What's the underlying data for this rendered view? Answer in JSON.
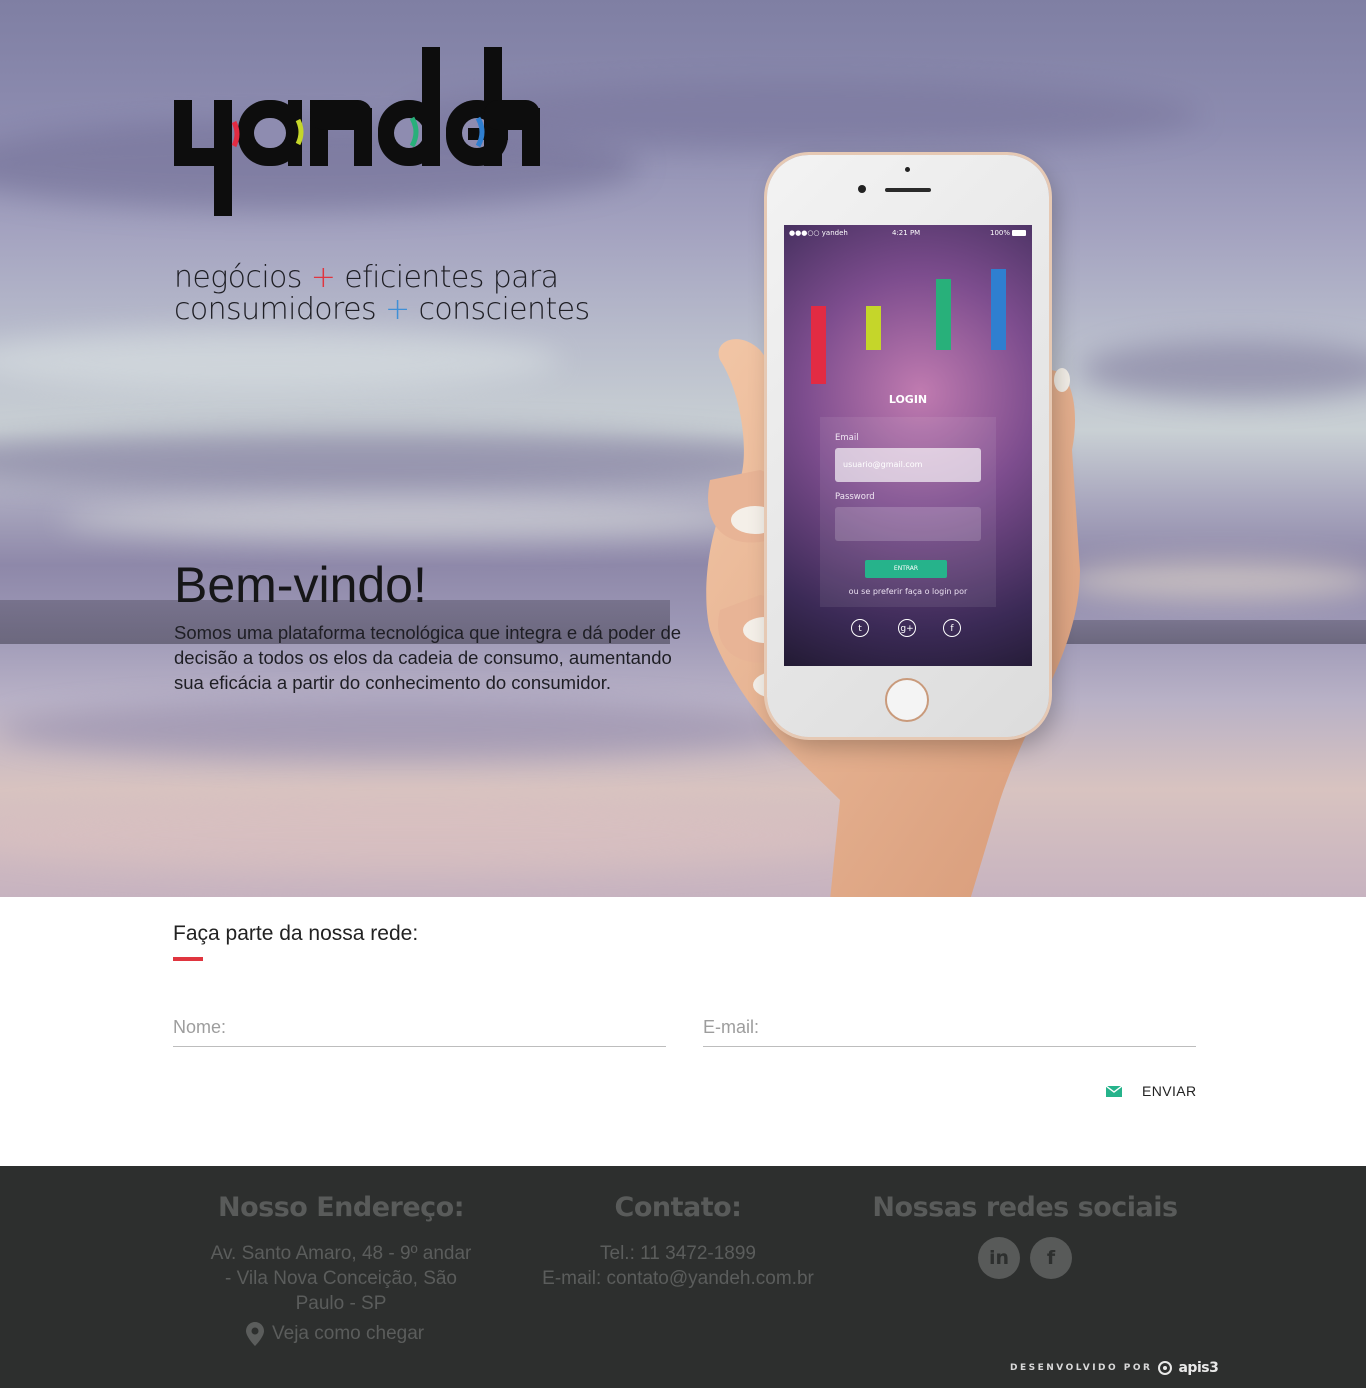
{
  "brand": {
    "logo_text": "yandeh",
    "tagline_line1_a": "negócios",
    "tagline_line1_plus": "+",
    "tagline_line1_b": "eficientes para",
    "tagline_line2_a": "consumidores",
    "tagline_line2_plus": "+",
    "tagline_line2_b": "conscientes"
  },
  "hero": {
    "welcome": "Bem-vindo!",
    "intro": "Somos uma plataforma tecnológica que integra e dá poder de decisão a todos os elos da cadeia de consumo, aumentando sua eficácia a partir do conhecimento do consumidor."
  },
  "phone_screen": {
    "carrier": "●●●○○ yandeh",
    "time": "4:21 PM",
    "battery": "100%",
    "login_title": "LOGIN",
    "email_label": "Email",
    "email_value": "usuario@gmail.com",
    "password_label": "Password",
    "submit_label": "ENTRAR",
    "alt_login": "ou se preferir faça o login por",
    "social_icons": [
      "twitter-icon",
      "google-plus-icon",
      "facebook-icon"
    ],
    "bar_colors": [
      "#e22b43",
      "#c5d62a",
      "#28b07a",
      "#2f7fd0"
    ]
  },
  "signup": {
    "title": "Faça parte da nossa rede:",
    "name_placeholder": "Nome:",
    "email_placeholder": "E-mail:",
    "send_label": "ENVIAR",
    "accent_color": "#e0353f",
    "send_icon_color": "#26b38b"
  },
  "footer": {
    "address_title": "Nosso Endereço:",
    "address_text": "Av. Santo Amaro, 48 - 9º andar - Vila Nova Conceição, São Paulo - SP",
    "directions_label": "Veja como chegar",
    "contact_title": "Contato:",
    "contact_phone": "Tel.: 11 3472-1899",
    "contact_email": "E-mail: contato@yandeh.com.br",
    "social_title": "Nossas redes sociais",
    "social_linkedin": "in",
    "social_facebook": "f",
    "credit_by": "DESENVOLVIDO POR",
    "credit_brand": "apis3"
  }
}
